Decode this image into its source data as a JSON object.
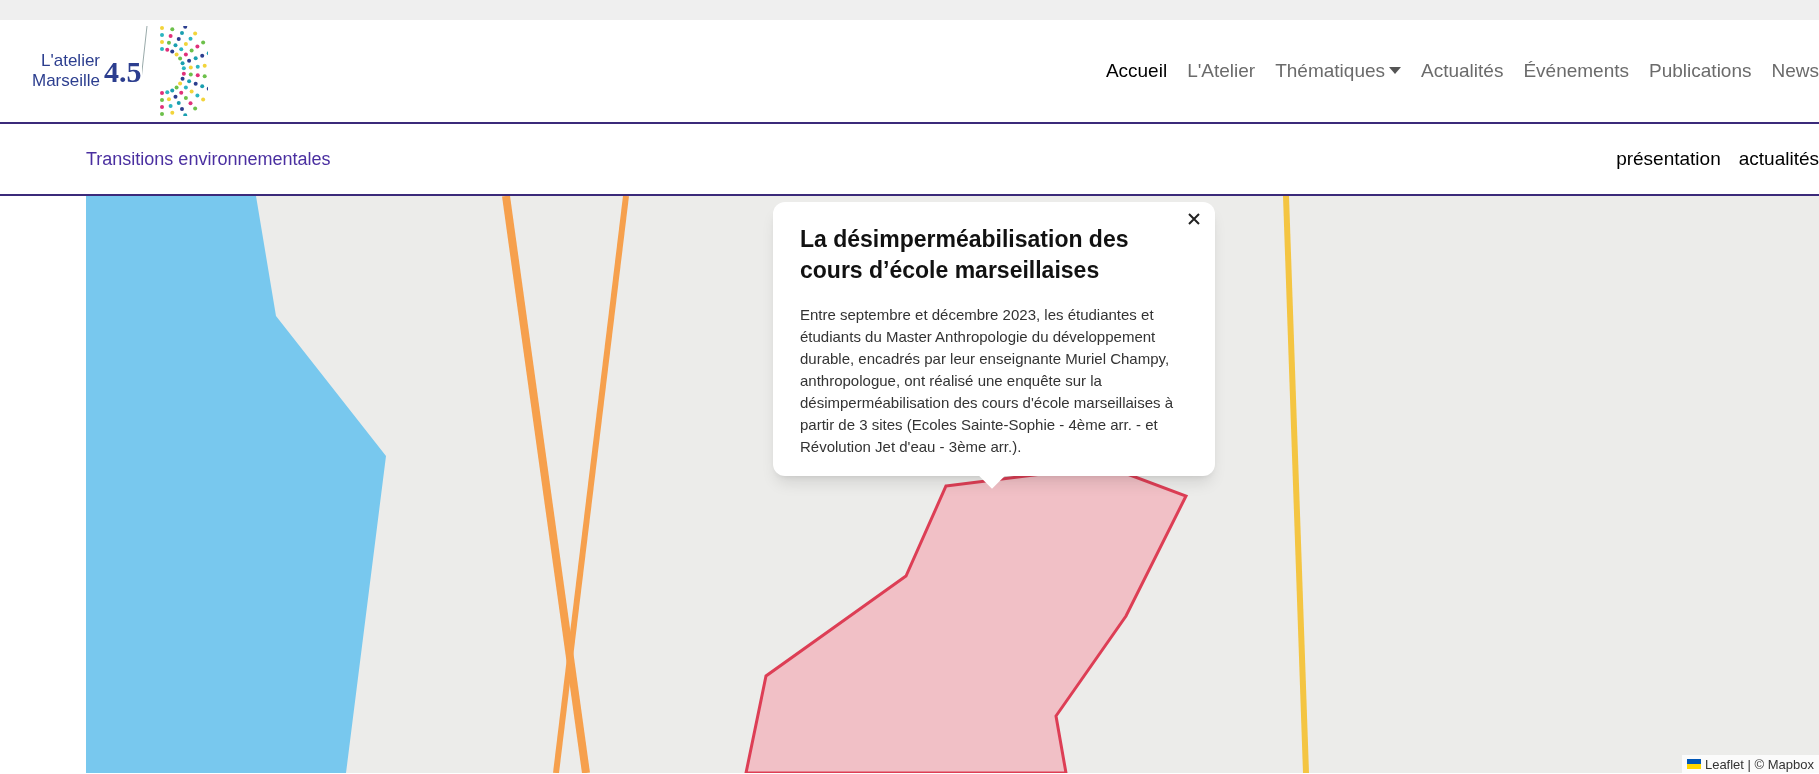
{
  "logo": {
    "line_1": "L'atelier",
    "line_2": "Marseille",
    "number": "4.5"
  },
  "nav": [
    {
      "label": "Accueil",
      "selected": true,
      "has_menu": false
    },
    {
      "label": "L'Atelier",
      "selected": false,
      "has_menu": false
    },
    {
      "label": "Thématiques",
      "selected": false,
      "has_menu": true
    },
    {
      "label": "Actualités",
      "selected": false,
      "has_menu": false
    },
    {
      "label": "Événements",
      "selected": false,
      "has_menu": false
    },
    {
      "label": "Publications",
      "selected": false,
      "has_menu": false
    },
    {
      "label": "News",
      "selected": false,
      "has_menu": false
    }
  ],
  "subnav": {
    "title": "Transitions environnementales",
    "links": [
      "présentation",
      "actualités"
    ]
  },
  "map": {
    "popup": {
      "title": "La désimperméabilisation des cours d’école marseillaises",
      "body": "Entre septembre et décembre 2023, les étudiantes et étudiants du Master Anthropologie du développement durable, encadrés par leur enseignante Muriel Champy, anthropologue, ont réalisé une enquête sur la désimperméabilisation des cours d'école marseillaises à partir de 3 sites (Ecoles Sainte-Sophie - 4ème arr. - et Révolution Jet d'eau - 3ème arr.)."
    },
    "attribution": "Leaflet | © Mapbox"
  }
}
